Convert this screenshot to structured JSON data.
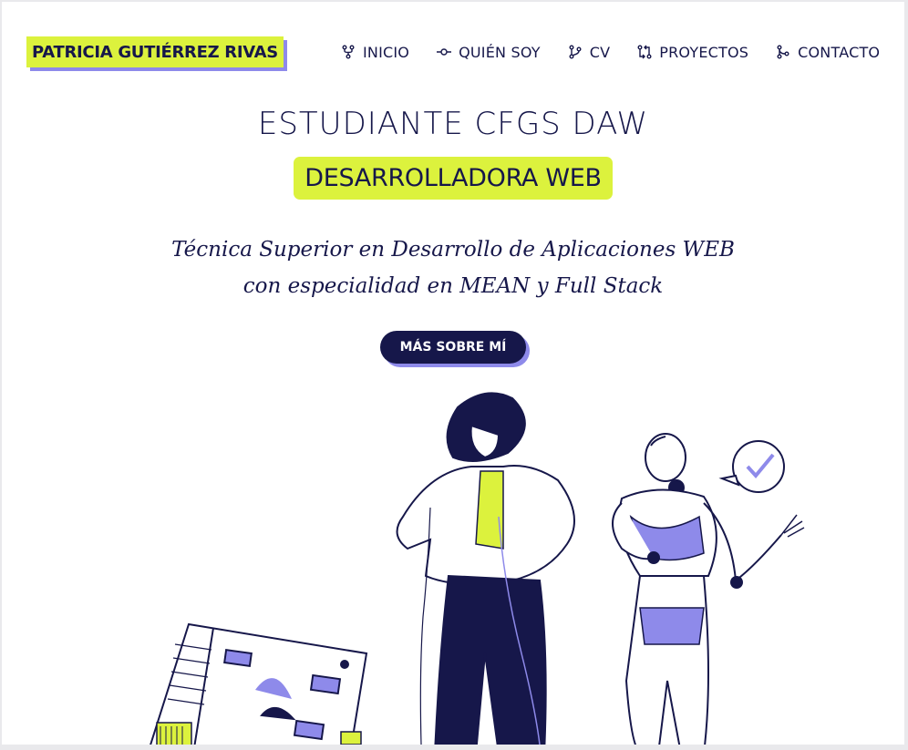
{
  "header": {
    "brand": "PATRICIA GUTIÉRREZ RIVAS",
    "nav": [
      {
        "label": "INICIO",
        "icon": "git-fork-icon"
      },
      {
        "label": "QUIÉN SOY",
        "icon": "git-commit-icon"
      },
      {
        "label": "CV",
        "icon": "git-branch-icon"
      },
      {
        "label": "PROYECTOS",
        "icon": "git-compare-icon"
      },
      {
        "label": "CONTACTO",
        "icon": "git-merge-icon"
      }
    ]
  },
  "hero": {
    "title": "ESTUDIANTE CFGS DAW",
    "highlight": "DESARROLLADORA WEB",
    "description_line1": "Técnica Superior en Desarrollo de Aplicaciones WEB",
    "description_line2": "con especialidad en MEAN y Full Stack",
    "cta": "MÁS SOBRE MÍ"
  },
  "colors": {
    "accent_lime": "#dcf23d",
    "accent_purple": "#8e8aea",
    "navy": "#16174a"
  }
}
